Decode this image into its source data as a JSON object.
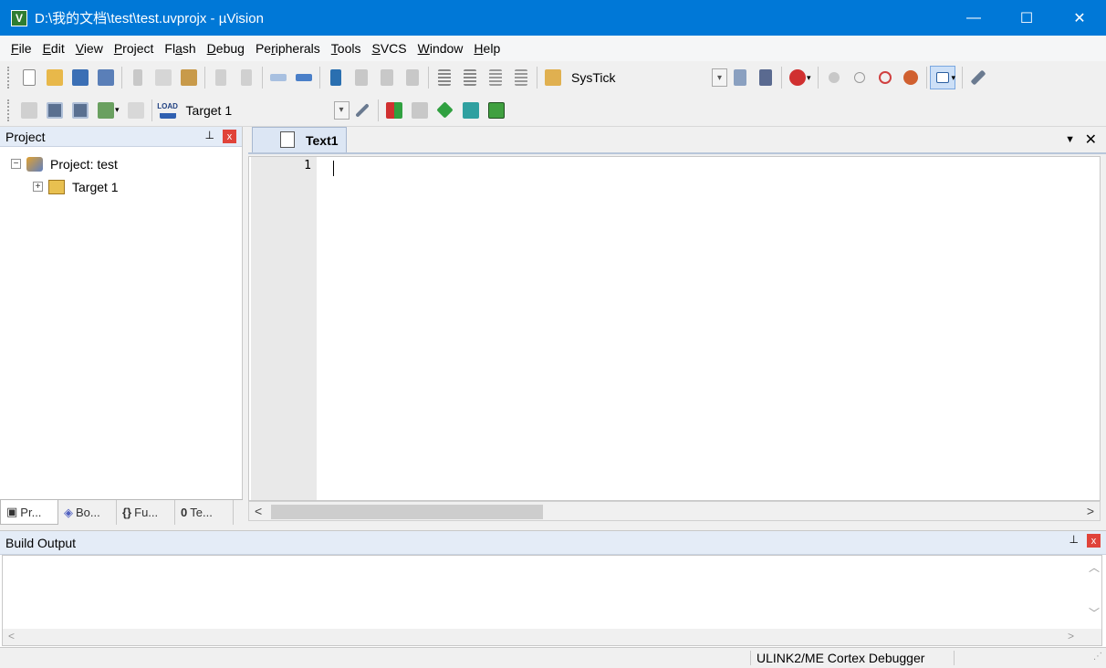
{
  "window": {
    "title": "D:\\我的文档\\test\\test.uvprojx - µVision",
    "app_icon": "V",
    "controls": {
      "minimize": "—",
      "maximize": "☐",
      "close": "✕"
    }
  },
  "menu": [
    {
      "u": "F",
      "rest": "ile"
    },
    {
      "u": "E",
      "rest": "dit"
    },
    {
      "u": "V",
      "rest": "iew"
    },
    {
      "u": "P",
      "rest": "roject"
    },
    {
      "u": "",
      "rest": "Fl",
      "u2": "a",
      "rest2": "sh"
    },
    {
      "u": "D",
      "rest": "ebug"
    },
    {
      "u": "",
      "rest": "Pe",
      "u2": "r",
      "rest2": "ipherals"
    },
    {
      "u": "T",
      "rest": "ools"
    },
    {
      "u": "S",
      "rest": "VCS"
    },
    {
      "u": "W",
      "rest": "indow"
    },
    {
      "u": "H",
      "rest": "elp"
    }
  ],
  "toolbar1": {
    "find_combo_value": "SysTick"
  },
  "toolbar2": {
    "target_combo_value": "Target 1",
    "load_label": "LOAD"
  },
  "project_panel": {
    "title": "Project",
    "pin": "𝟖",
    "close": "x",
    "root_label": "Project: test",
    "target_label": "Target 1",
    "tabs": [
      {
        "icon": "▣",
        "label": "Pr..."
      },
      {
        "icon": "◈",
        "label": "Bo..."
      },
      {
        "icon": "{}",
        "label": "Fu..."
      },
      {
        "icon": "0",
        "label": "Te..."
      }
    ]
  },
  "editor": {
    "tab_label": "Text1",
    "line_number": "1",
    "left_arrow": "<",
    "right_arrow": ">"
  },
  "build_output": {
    "title": "Build Output"
  },
  "status": {
    "debugger": "ULINK2/ME Cortex Debugger"
  },
  "colors": {
    "titlebar": "#0078d7",
    "panel_header": "#e4ecf7",
    "close_red": "#e0433a"
  }
}
